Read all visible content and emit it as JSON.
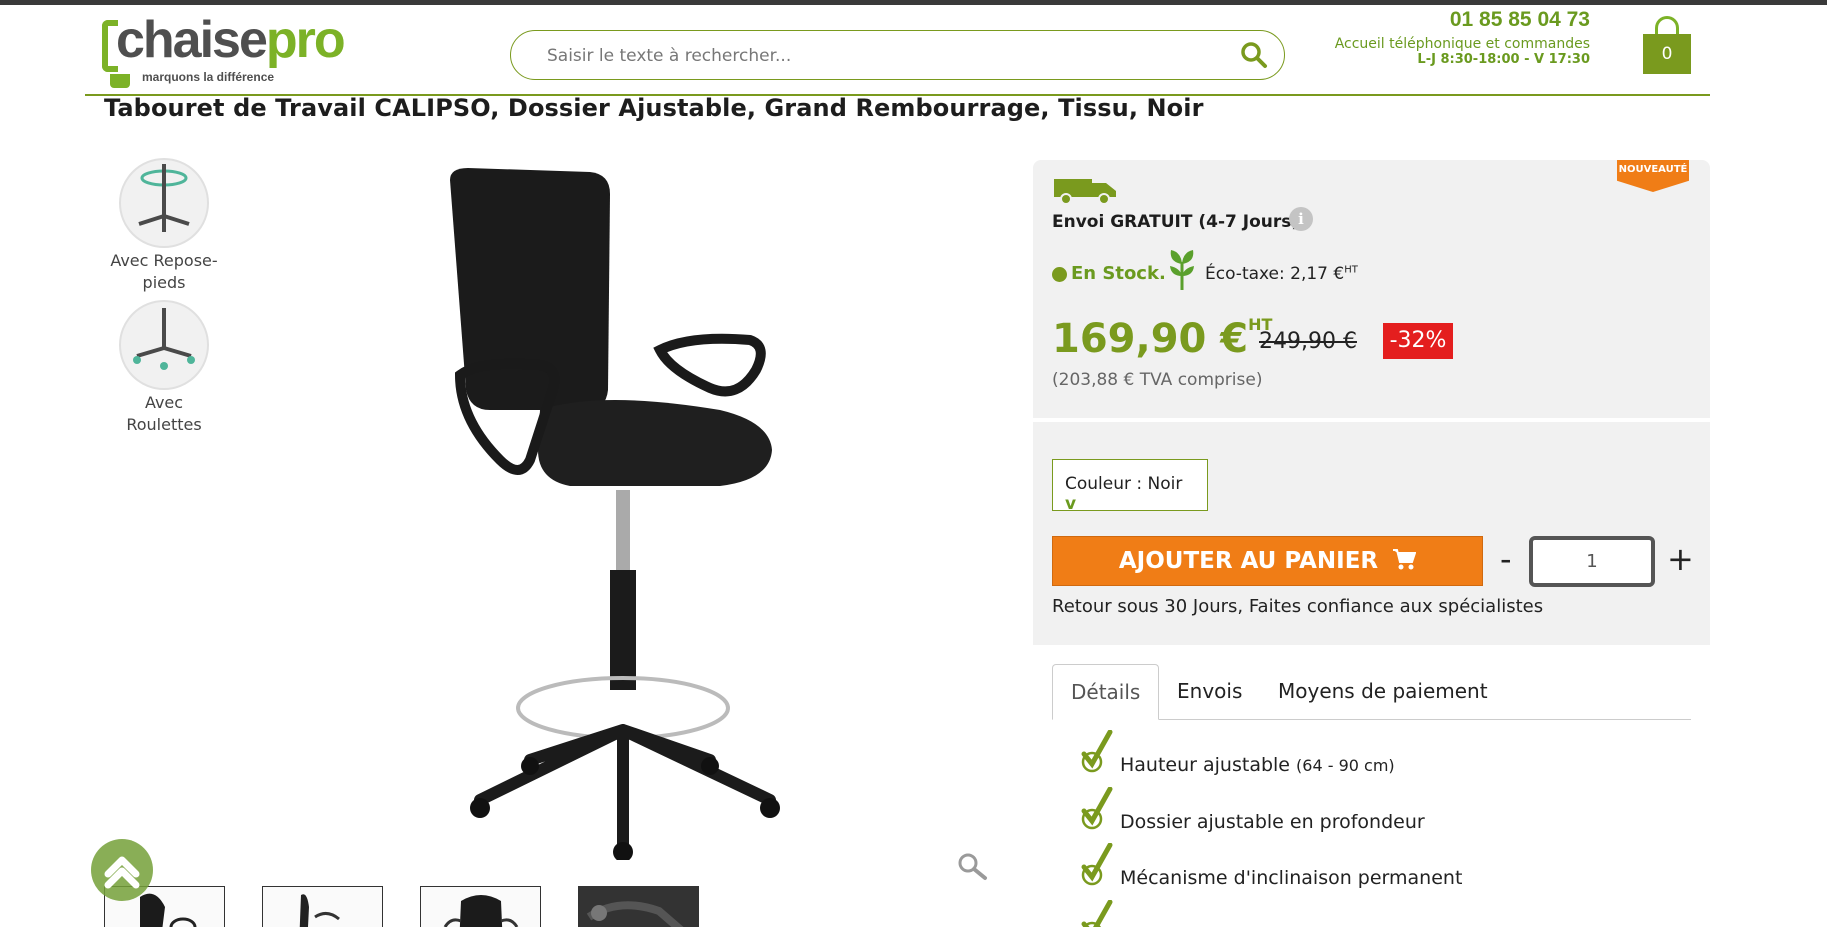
{
  "header": {
    "logo_main_a": "chaise",
    "logo_main_b": "pro",
    "logo_tagline": "marquons la différence",
    "search_placeholder": "Saisir le texte à rechercher...",
    "phone": "01 85 85 04 73",
    "hours_line1": "Accueil téléphonique et commandes",
    "hours_line2": "L-J 8:30-18:00 - V 17:30",
    "cart_count": "0"
  },
  "product": {
    "title": "Tabouret de Travail CALIPSO, Dossier Ajustable, Grand Rembourrage, Tissu, Noir",
    "options": [
      {
        "label": "Avec Repose-pieds"
      },
      {
        "label": "Avec Roulettes"
      }
    ],
    "badge": "NOUVEAUTÉ",
    "shipping": "Envoi GRATUIT (4-7 Jours)",
    "info_glyph": "i",
    "stock": "En Stock.",
    "eco_tax": "Éco-taxe: 2,17 €",
    "eco_sup": "HT",
    "price": "169,90 €",
    "price_sup": "HT",
    "old_price": "249,90 €",
    "discount": "-32%",
    "price_ttc": "(203,88 € TVA comprise)",
    "color_label": "Couleur : Noir",
    "color_caret": "v",
    "add_to_cart": "AJOUTER AU PANIER",
    "qty_minus": "-",
    "qty_value": "1",
    "qty_plus": "+",
    "return_policy": "Retour sous 30 Jours, Faites confiance aux spécialistes",
    "tabs": [
      {
        "label": "Détails"
      },
      {
        "label": "Envois"
      },
      {
        "label": "Moyens de paiement"
      }
    ],
    "features": [
      {
        "text": "Hauteur ajustable ",
        "small": "(64 - 90 cm)"
      },
      {
        "text": "Dossier ajustable en profondeur",
        "small": ""
      },
      {
        "text": "Mécanisme d'inclinaison permanent",
        "small": ""
      }
    ]
  },
  "colors": {
    "brand_green": "#7cb227",
    "dark_green": "#6a9a1f",
    "orange": "#f07d16",
    "red": "#e41e1e",
    "panel_bg": "#f1f1f1"
  },
  "icons": [
    "search-icon",
    "cart-icon",
    "truck-icon",
    "info-icon",
    "leaf-icon",
    "cart-small-icon",
    "check-icon",
    "zoom-icon",
    "chevron-up-icon"
  ]
}
